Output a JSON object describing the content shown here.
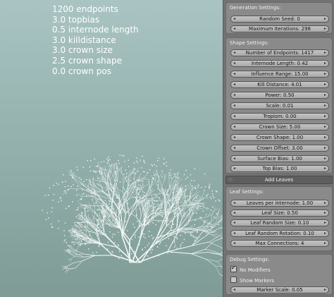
{
  "overlay": {
    "lines": [
      "1200 endpoints",
      "3.0 topbias",
      "0.5 internode length",
      "3.0 killdistance",
      "3.0 crown size",
      "2.5 crown shape",
      "0.0 crown pos"
    ]
  },
  "generation": {
    "title": "Generation Settings:",
    "random_seed": "Random Seed: 0",
    "max_iterations": "Maximum Iterations: 298"
  },
  "shape": {
    "title": "Shape Settings:",
    "fields": [
      "Number of Endpoints: 1417",
      "Internode Length: 0.42",
      "Influence Range: 15.00",
      "Kill Distance: 4.01",
      "Power: 0.50",
      "Scale: 0.01",
      "Tropism: 0.00",
      "Crown Size: 5.00",
      "Crown Shape: 1.00",
      "Crown Offset: 3.00",
      "Surface Bias: 1.00",
      "Top Bias: 1.00"
    ]
  },
  "add_leaves": {
    "label": "Add Leaves",
    "grip": ":::"
  },
  "leaf": {
    "title": "Leaf Settings:",
    "fields": [
      "Leaves per internode: 1.00",
      "Leaf Size: 0.50",
      "Leaf Random Size: 0.10",
      "Leaf Random Rotation: 0.10",
      "Max Connections: 4"
    ]
  },
  "debug": {
    "title": "Debug Settings:",
    "no_modifiers": {
      "label": "No Modifiers",
      "checked": true
    },
    "show_markers": {
      "label": "Show Markers",
      "checked": false
    },
    "marker_scale": "Marker Scale: 0.05"
  },
  "glyphs": {
    "left": "◂",
    "right": "▸",
    "tick": "✔"
  },
  "colors": {
    "tree": "#f2f7f4",
    "panel": "#727272",
    "field": "#b7b7b7",
    "add_button": "#5e5e5e"
  }
}
